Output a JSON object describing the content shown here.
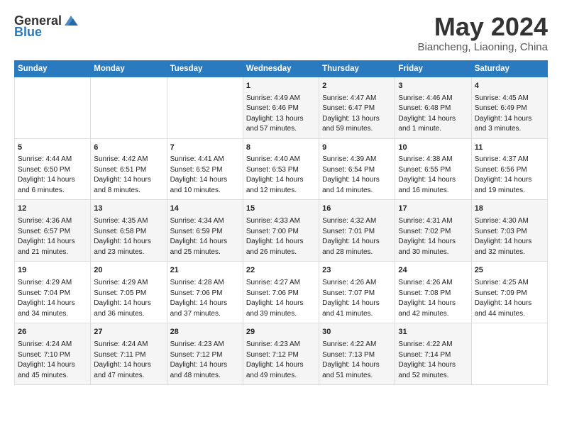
{
  "logo": {
    "general": "General",
    "blue": "Blue"
  },
  "title": {
    "month_year": "May 2024",
    "location": "Biancheng, Liaoning, China"
  },
  "headers": [
    "Sunday",
    "Monday",
    "Tuesday",
    "Wednesday",
    "Thursday",
    "Friday",
    "Saturday"
  ],
  "weeks": [
    [
      {
        "day": "",
        "content": ""
      },
      {
        "day": "",
        "content": ""
      },
      {
        "day": "",
        "content": ""
      },
      {
        "day": "1",
        "content": "Sunrise: 4:49 AM\nSunset: 6:46 PM\nDaylight: 13 hours and 57 minutes."
      },
      {
        "day": "2",
        "content": "Sunrise: 4:47 AM\nSunset: 6:47 PM\nDaylight: 13 hours and 59 minutes."
      },
      {
        "day": "3",
        "content": "Sunrise: 4:46 AM\nSunset: 6:48 PM\nDaylight: 14 hours and 1 minute."
      },
      {
        "day": "4",
        "content": "Sunrise: 4:45 AM\nSunset: 6:49 PM\nDaylight: 14 hours and 3 minutes."
      }
    ],
    [
      {
        "day": "5",
        "content": "Sunrise: 4:44 AM\nSunset: 6:50 PM\nDaylight: 14 hours and 6 minutes."
      },
      {
        "day": "6",
        "content": "Sunrise: 4:42 AM\nSunset: 6:51 PM\nDaylight: 14 hours and 8 minutes."
      },
      {
        "day": "7",
        "content": "Sunrise: 4:41 AM\nSunset: 6:52 PM\nDaylight: 14 hours and 10 minutes."
      },
      {
        "day": "8",
        "content": "Sunrise: 4:40 AM\nSunset: 6:53 PM\nDaylight: 14 hours and 12 minutes."
      },
      {
        "day": "9",
        "content": "Sunrise: 4:39 AM\nSunset: 6:54 PM\nDaylight: 14 hours and 14 minutes."
      },
      {
        "day": "10",
        "content": "Sunrise: 4:38 AM\nSunset: 6:55 PM\nDaylight: 14 hours and 16 minutes."
      },
      {
        "day": "11",
        "content": "Sunrise: 4:37 AM\nSunset: 6:56 PM\nDaylight: 14 hours and 19 minutes."
      }
    ],
    [
      {
        "day": "12",
        "content": "Sunrise: 4:36 AM\nSunset: 6:57 PM\nDaylight: 14 hours and 21 minutes."
      },
      {
        "day": "13",
        "content": "Sunrise: 4:35 AM\nSunset: 6:58 PM\nDaylight: 14 hours and 23 minutes."
      },
      {
        "day": "14",
        "content": "Sunrise: 4:34 AM\nSunset: 6:59 PM\nDaylight: 14 hours and 25 minutes."
      },
      {
        "day": "15",
        "content": "Sunrise: 4:33 AM\nSunset: 7:00 PM\nDaylight: 14 hours and 26 minutes."
      },
      {
        "day": "16",
        "content": "Sunrise: 4:32 AM\nSunset: 7:01 PM\nDaylight: 14 hours and 28 minutes."
      },
      {
        "day": "17",
        "content": "Sunrise: 4:31 AM\nSunset: 7:02 PM\nDaylight: 14 hours and 30 minutes."
      },
      {
        "day": "18",
        "content": "Sunrise: 4:30 AM\nSunset: 7:03 PM\nDaylight: 14 hours and 32 minutes."
      }
    ],
    [
      {
        "day": "19",
        "content": "Sunrise: 4:29 AM\nSunset: 7:04 PM\nDaylight: 14 hours and 34 minutes."
      },
      {
        "day": "20",
        "content": "Sunrise: 4:29 AM\nSunset: 7:05 PM\nDaylight: 14 hours and 36 minutes."
      },
      {
        "day": "21",
        "content": "Sunrise: 4:28 AM\nSunset: 7:06 PM\nDaylight: 14 hours and 37 minutes."
      },
      {
        "day": "22",
        "content": "Sunrise: 4:27 AM\nSunset: 7:06 PM\nDaylight: 14 hours and 39 minutes."
      },
      {
        "day": "23",
        "content": "Sunrise: 4:26 AM\nSunset: 7:07 PM\nDaylight: 14 hours and 41 minutes."
      },
      {
        "day": "24",
        "content": "Sunrise: 4:26 AM\nSunset: 7:08 PM\nDaylight: 14 hours and 42 minutes."
      },
      {
        "day": "25",
        "content": "Sunrise: 4:25 AM\nSunset: 7:09 PM\nDaylight: 14 hours and 44 minutes."
      }
    ],
    [
      {
        "day": "26",
        "content": "Sunrise: 4:24 AM\nSunset: 7:10 PM\nDaylight: 14 hours and 45 minutes."
      },
      {
        "day": "27",
        "content": "Sunrise: 4:24 AM\nSunset: 7:11 PM\nDaylight: 14 hours and 47 minutes."
      },
      {
        "day": "28",
        "content": "Sunrise: 4:23 AM\nSunset: 7:12 PM\nDaylight: 14 hours and 48 minutes."
      },
      {
        "day": "29",
        "content": "Sunrise: 4:23 AM\nSunset: 7:12 PM\nDaylight: 14 hours and 49 minutes."
      },
      {
        "day": "30",
        "content": "Sunrise: 4:22 AM\nSunset: 7:13 PM\nDaylight: 14 hours and 51 minutes."
      },
      {
        "day": "31",
        "content": "Sunrise: 4:22 AM\nSunset: 7:14 PM\nDaylight: 14 hours and 52 minutes."
      },
      {
        "day": "",
        "content": ""
      }
    ]
  ]
}
